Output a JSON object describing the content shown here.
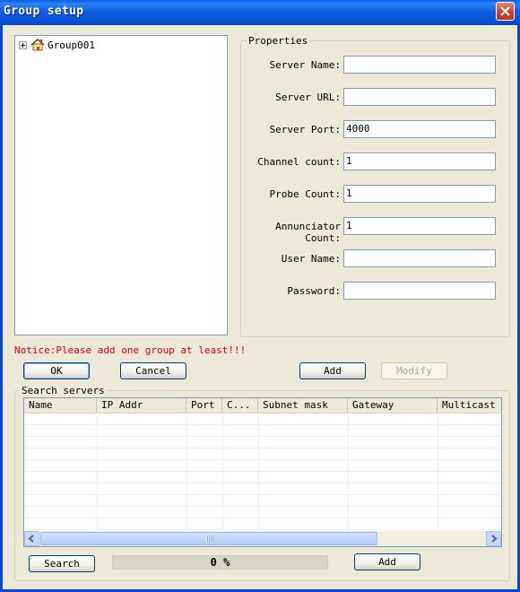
{
  "window": {
    "title": "Group setup",
    "close_icon": "close-icon"
  },
  "tree": {
    "items": [
      {
        "label": "Group001",
        "icon": "house-icon",
        "expanded": false
      }
    ]
  },
  "properties": {
    "legend": "Properties",
    "fields": {
      "server_name": {
        "label": "Server Name:",
        "value": ""
      },
      "server_url": {
        "label": "Server URL:",
        "value": ""
      },
      "server_port": {
        "label": "Server Port:",
        "value": "4000"
      },
      "channel_count": {
        "label": "Channel count:",
        "value": "1"
      },
      "probe_count": {
        "label": "Probe Count:",
        "value": "1"
      },
      "annunciator_count": {
        "label": "Annunciator Count:",
        "value": "1"
      },
      "user_name": {
        "label": "User Name:",
        "value": ""
      },
      "password": {
        "label": "Password:",
        "value": ""
      }
    }
  },
  "notice": "Notice:Please add one group at least!!!",
  "buttons": {
    "ok": "OK",
    "cancel": "Cancel",
    "add": "Add",
    "modify": "Modify"
  },
  "search": {
    "legend": "Search servers",
    "columns": [
      "Name",
      "IP Addr",
      "Port",
      "C...",
      "Subnet mask",
      "Gateway",
      "Multicast a"
    ],
    "rows": [],
    "search_button": "Search",
    "progress_text": "0 %",
    "progress_value": 0,
    "add_button": "Add"
  },
  "colors": {
    "title_bar": "#0a5ff0",
    "notice_text": "#e00000",
    "dialog_bg": "#ece9d8"
  }
}
